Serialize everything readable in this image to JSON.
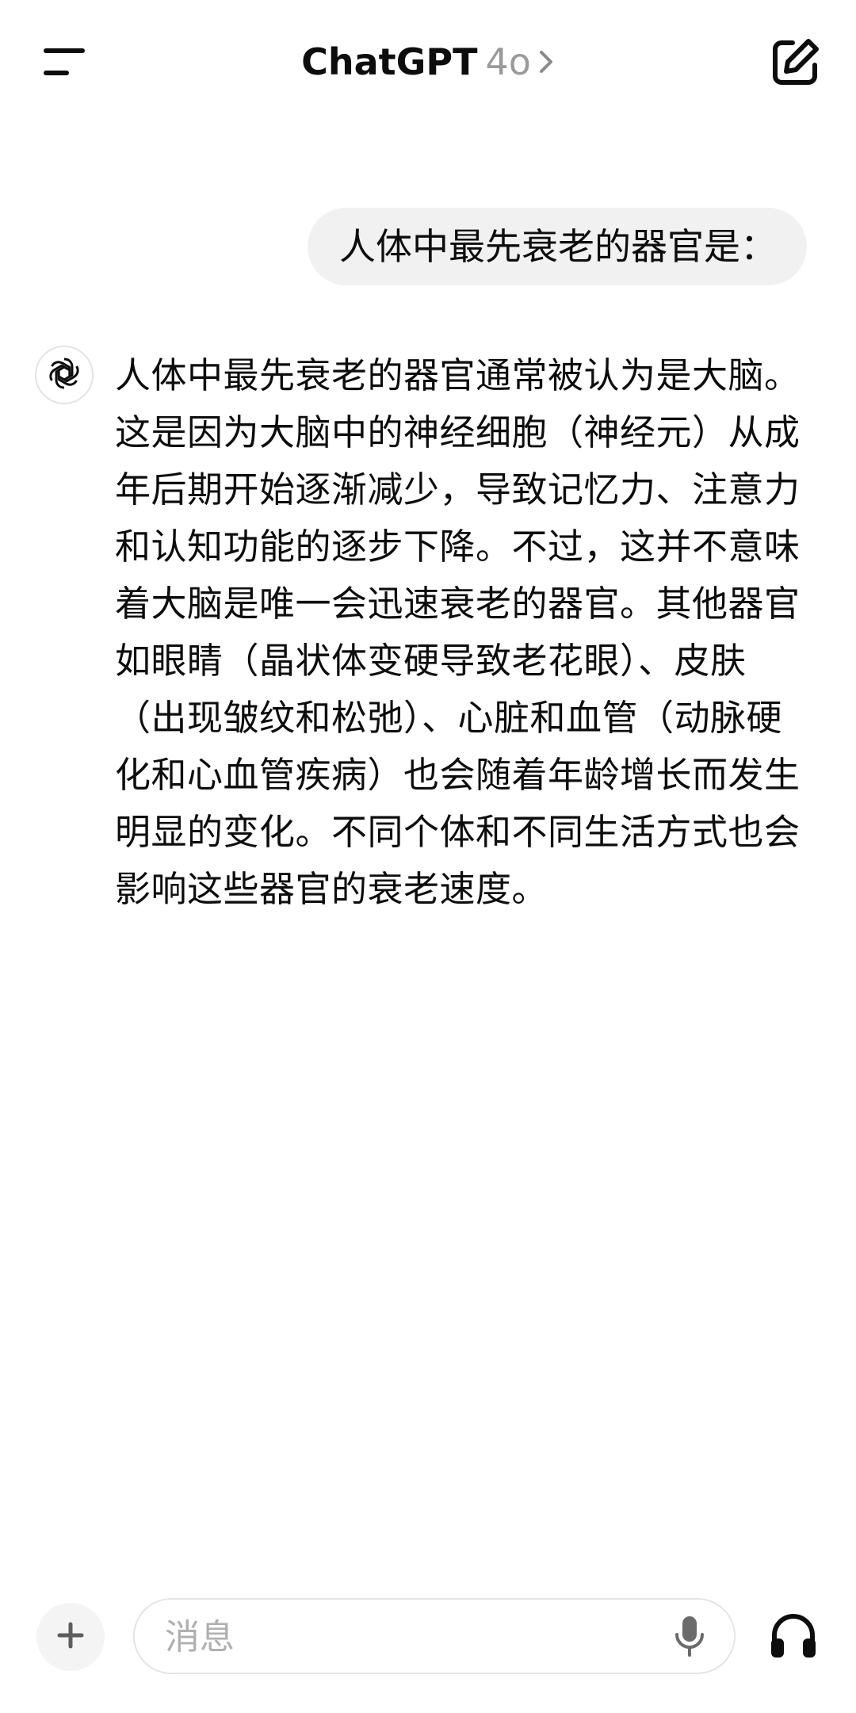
{
  "header": {
    "app_name": "ChatGPT",
    "model_name": "4o",
    "icons": {
      "menu": "menu-icon",
      "chevron": "chevron-right-icon",
      "new_chat": "new-chat-icon"
    }
  },
  "conversation": {
    "user_message": "人体中最先衰老的器官是：",
    "assistant_message": "人体中最先衰老的器官通常被认为是大脑。这是因为大脑中的神经细胞（神经元）从成年后期开始逐渐减少，导致记忆力、注意力和认知功能的逐步下降。不过，这并不意味着大脑是唯一会迅速衰老的器官。其他器官如眼睛（晶状体变硬导致老花眼）、皮肤（出现皱纹和松弛）、心脏和血管（动脉硬化和心血管疾病）也会随着年龄增长而发生明显的变化。不同个体和不同生活方式也会影响这些器官的衰老速度。",
    "assistant_avatar_icon": "openai-logo-icon"
  },
  "composer": {
    "placeholder": "消息",
    "value": "",
    "icons": {
      "attach": "plus-icon",
      "mic": "mic-icon",
      "voice": "headphones-icon"
    }
  },
  "colors": {
    "background": "#ffffff",
    "text": "#0d0d0d",
    "muted": "#9a9a9a",
    "bubble": "#f1f1f1",
    "border": "#e5e5e5"
  }
}
